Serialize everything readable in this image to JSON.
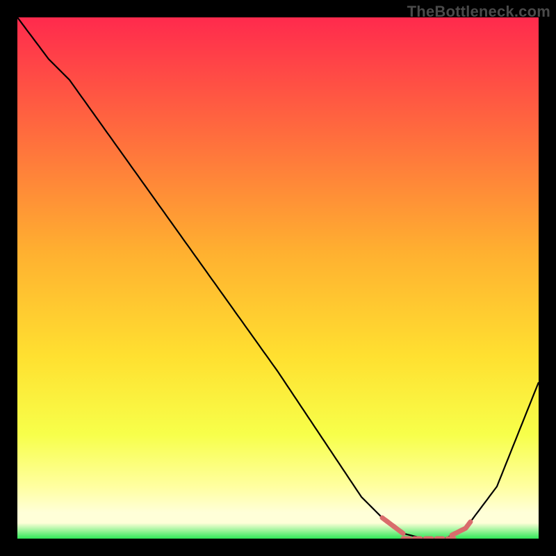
{
  "watermark": "TheBottleneck.com",
  "colors": {
    "background": "#000000",
    "curve": "#000000",
    "highlight": "#d96c6c",
    "grad_top": "#ff2a4d",
    "grad_mid1": "#ff6b3e",
    "grad_mid2": "#ffb030",
    "grad_mid3": "#ffe030",
    "grad_mid4": "#f7ff4a",
    "grad_bottom1": "#ffffa0",
    "grad_bottom2": "#ffffd8",
    "grad_green": "#30e858"
  },
  "chart_data": {
    "type": "line",
    "title": "",
    "xlabel": "",
    "ylabel": "",
    "xlim": [
      0,
      100
    ],
    "ylim": [
      0,
      100
    ],
    "x": [
      0,
      6,
      10,
      20,
      30,
      40,
      50,
      58,
      62,
      66,
      70,
      74,
      78,
      82,
      86,
      92,
      100
    ],
    "values": [
      100,
      92,
      88,
      74,
      60,
      46,
      32,
      20,
      14,
      8,
      4,
      1,
      0,
      0,
      2,
      10,
      30
    ],
    "valley_flat": {
      "x_start": 74,
      "x_end": 84,
      "value": 0
    },
    "highlight_segments": [
      {
        "x_start": 70,
        "x_end": 74
      },
      {
        "x_start": 83,
        "x_end": 87
      }
    ]
  }
}
